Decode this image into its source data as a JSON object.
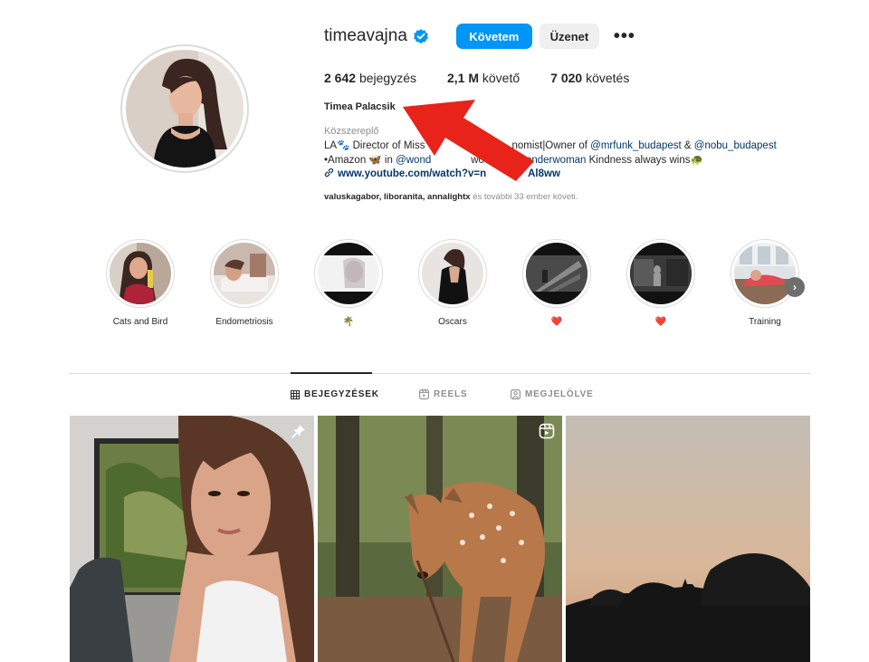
{
  "profile": {
    "username": "timeavajna",
    "verified": true,
    "follow_label": "Követem",
    "message_label": "Üzenet",
    "more_label": "•••",
    "full_name": "Timea Palacsik",
    "category": "Közszereplő",
    "bio_line1_prefix": "LA🐾 Director of Miss",
    "bio_line1_mid": "nomist|Owner of",
    "bio_mention1": "@mrfunk_budapest",
    "bio_amp": "&",
    "bio_mention2": "@nobu_budapest",
    "bio_line2_prefix": "•Amazon 🦋 in",
    "bio_mention3": "@wond",
    "bio_line2_mid": "wo",
    "bio_mention4": "onderwoman",
    "bio_line2_suffix": "Kindness always wins🐢",
    "link_text_start": "www.youtube.com/watch?v=n",
    "link_text_end": "Al8ww",
    "followed_by_names": "valuskagabor, liboranita, annalightx",
    "followed_by_suffix": "és további 33 ember követi."
  },
  "stats": [
    {
      "value": "2 642",
      "label": "bejegyzés"
    },
    {
      "value": "2,1 M",
      "label": "követő"
    },
    {
      "value": "7 020",
      "label": "követés"
    }
  ],
  "highlights": [
    {
      "label": "Cats and Bird",
      "image": "woman-with-bird"
    },
    {
      "label": "Endometriosis",
      "image": "hospital-bed"
    },
    {
      "label": "🌴",
      "image": "bw-film-frame"
    },
    {
      "label": "Oscars",
      "image": "woman-back-dress"
    },
    {
      "label": "❤️",
      "image": "bw-stairs"
    },
    {
      "label": "❤️",
      "image": "bw-interior"
    },
    {
      "label": "Training",
      "image": "gym-room"
    }
  ],
  "tabs": [
    {
      "label": "BEJEGYZÉSEK",
      "icon": "grid-icon",
      "active": true
    },
    {
      "label": "REELS",
      "icon": "reels-icon",
      "active": false
    },
    {
      "label": "MEGJELÖLVE",
      "icon": "tagged-icon",
      "active": false
    }
  ],
  "posts": [
    {
      "subject": "selfie-woman-by-window",
      "badge": "pin-icon"
    },
    {
      "subject": "fawn-in-forest",
      "badge": "reels-icon"
    },
    {
      "subject": "deer-silhouette-dusk",
      "badge": ""
    }
  ],
  "colors": {
    "accent": "#0095f6",
    "arrow": "#e8231a",
    "mention": "#00376b",
    "muted": "#8e8e8e"
  }
}
